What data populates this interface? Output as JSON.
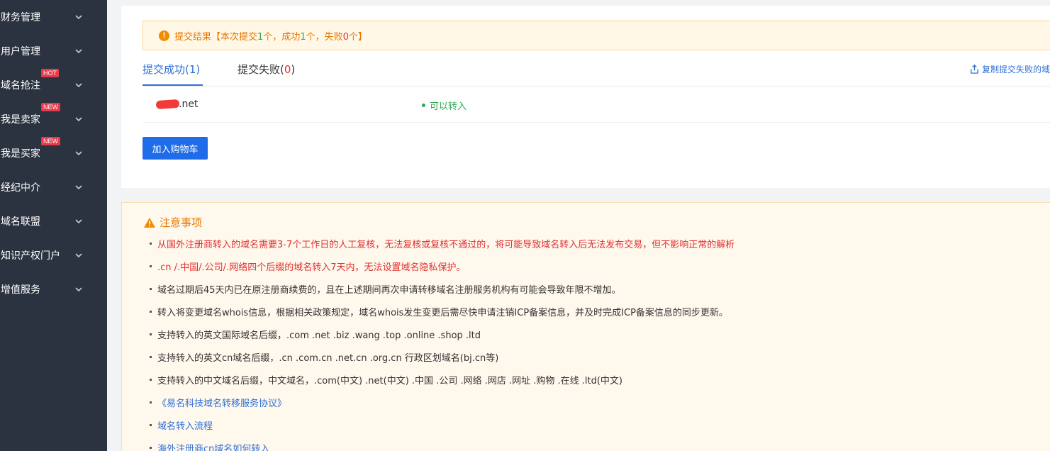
{
  "sidebar": {
    "items": [
      {
        "label": "财务管理",
        "badge": ""
      },
      {
        "label": "用户管理",
        "badge": ""
      },
      {
        "label": "域名抢注",
        "badge": "HOT"
      },
      {
        "label": "我是卖家",
        "badge": "NEW"
      },
      {
        "label": "我是买家",
        "badge": "NEW"
      },
      {
        "label": "经纪中介",
        "badge": ""
      },
      {
        "label": "域名联盟",
        "badge": ""
      },
      {
        "label": "知识产权门户",
        "badge": ""
      },
      {
        "label": "增值服务",
        "badge": ""
      }
    ]
  },
  "result": {
    "alert": {
      "prefix": "提交结果【本次提交",
      "submitted": "1",
      "mid1": "个，成功",
      "success": "1",
      "mid2": "个，失败",
      "failed": "0",
      "suffix": "个】"
    },
    "tabs": {
      "success_label": "提交成功(",
      "success_count": "1",
      "failed_label": "提交失败(",
      "failed_count": "0",
      "close_paren": ")"
    },
    "copy_failed_label": "复制提交失败的域",
    "rows": [
      {
        "domain_suffix": ".net",
        "status": "可以转入"
      }
    ],
    "add_to_cart_label": "加入购物车"
  },
  "notice": {
    "title": "注意事项",
    "items": [
      {
        "text": "从国外注册商转入的域名需要3-7个工作日的人工复核，无法复核或复核不通过的，将可能导致域名转入后无法发布交易，但不影响正常的解析",
        "color": "red"
      },
      {
        "text": ".cn /.中国/.公司/.网络四个后缀的域名转入7天内，无法设置域名隐私保护。",
        "color": "red"
      },
      {
        "text": "域名过期后45天内已在原注册商续费的，且在上述期间再次申请转移域名注册服务机构有可能会导致年限不增加。",
        "color": "dark"
      },
      {
        "text": "转入将变更域名whois信息，根据相关政策规定，域名whois发生变更后需尽快申请注销ICP备案信息，并及时完成ICP备案信息的同步更新。",
        "color": "dark"
      },
      {
        "text": "支持转入的英文国际域名后缀，.com .net .biz .wang .top .online .shop .ltd",
        "color": "dark"
      },
      {
        "text": "支持转入的英文cn域名后缀，.cn .com.cn .net.cn .org.cn 行政区划域名(bj.cn等)",
        "color": "dark"
      },
      {
        "text": "支持转入的中文域名后缀，中文域名，.com(中文) .net(中文) .中国 .公司 .网络 .网店 .网址 .购物 .在线 .ltd(中文)",
        "color": "dark"
      },
      {
        "text": "《易名科技域名转移服务协议》",
        "color": "blue"
      },
      {
        "text": "域名转入流程",
        "color": "blue"
      },
      {
        "text": "海外注册商cn域名如何转入",
        "color": "blue"
      }
    ]
  }
}
